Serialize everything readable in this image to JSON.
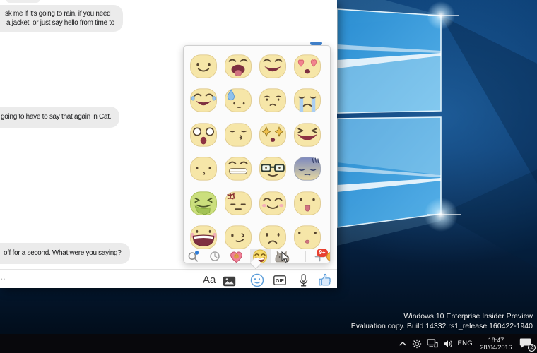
{
  "chat": {
    "bubbles": [
      {
        "lines": [
          "sk me if it's going to rain, if you need",
          "a jacket, or just say hello from time to"
        ]
      },
      {
        "lines": [
          "going to have to say that again in Cat."
        ]
      },
      {
        "lines": [
          "off for a second. What were you saying?"
        ]
      }
    ],
    "composer_text": "..."
  },
  "composer": {
    "format_label": "Aa",
    "gif_label": "GIF",
    "icons": [
      "photo-icon",
      "emoji-icon",
      "gif-icon",
      "microphone-icon",
      "like-thumb-icon"
    ]
  },
  "sticker_panel": {
    "stickers": [
      "smile",
      "tongue-laugh",
      "grin-laugh",
      "heart-eyes",
      "laugh-tears",
      "cold-sweat",
      "worried",
      "crying",
      "shocked",
      "kiss",
      "star-eyes",
      "squint-laugh",
      "dot-eyes",
      "teeth-grin",
      "glasses",
      "gloom",
      "sick-green",
      "angry-mark",
      "blush-smile",
      "tongue-out",
      "big-laugh",
      "wink",
      "frown",
      "baby-tongue"
    ],
    "toolbar": {
      "tabs": [
        "search",
        "recent",
        "heart-pack",
        "emoji-pack",
        "pusheen-pack",
        "add-pack"
      ],
      "selected_tab": "emoji-pack",
      "badge": "9+"
    }
  },
  "desktop": {
    "watermark_line1": "Windows 10 Enterprise Insider Preview",
    "watermark_line2": "Evaluation copy. Build 14332.rs1_release.160422-1940"
  },
  "taskbar": {
    "language": "ENG",
    "time": "18:47",
    "date": "28/04/2016",
    "notification_count": "2"
  },
  "colors": {
    "accent_blue": "#5b9dd9",
    "bubble_gray": "#ebebeb",
    "badge_red": "#e8402f",
    "scrollbar_blue": "#3f7fc8",
    "taskbar_black": "#08080c"
  }
}
